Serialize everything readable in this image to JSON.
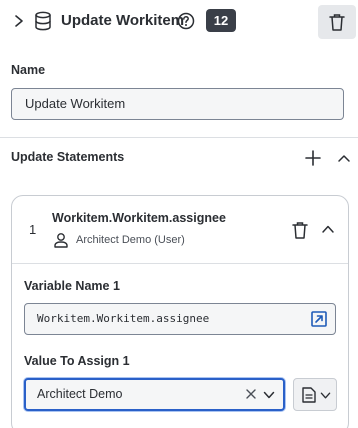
{
  "header": {
    "title": "Update Workitem",
    "count_badge": "12",
    "icons": [
      "chevron-right-icon",
      "database-icon",
      "help-circle-icon",
      "trash-icon"
    ]
  },
  "name_field": {
    "label": "Name",
    "value": "Update Workitem"
  },
  "update_statements": {
    "label": "Update Statements",
    "items": [
      {
        "index": "1",
        "title": "Workitem.Workitem.assignee",
        "subtitle": "Architect Demo (User)",
        "variable_label": "Variable Name 1",
        "variable_value": "Workitem.Workitem.assignee",
        "value_label": "Value To Assign 1",
        "value_selected": "Architect Demo"
      }
    ]
  },
  "colors": {
    "text": "#2b2e33",
    "badge_bg": "#3a3f48",
    "focus_border": "#2a60c8",
    "link_icon": "#1f5bb8",
    "field_bg": "#f5f6f7"
  }
}
